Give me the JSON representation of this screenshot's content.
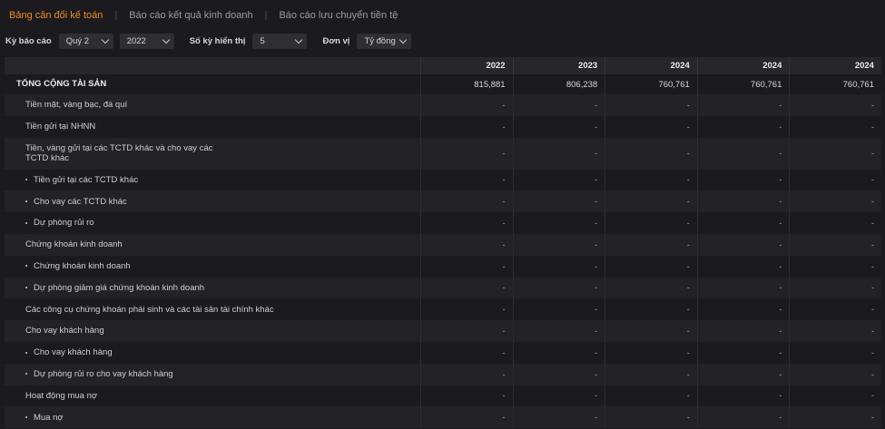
{
  "tabs": [
    {
      "label": "Bảng cân đối kế toán",
      "active": true
    },
    {
      "label": "Báo cáo kết quả kinh doanh",
      "active": false
    },
    {
      "label": "Báo cáo lưu chuyển tiền tệ",
      "active": false
    }
  ],
  "tab_separator": "|",
  "filters": {
    "period_label": "Kỳ báo cáo",
    "quarter_value": "Quý 2",
    "year_value": "2022",
    "count_label": "Số kỳ hiển thị",
    "count_value": "5",
    "unit_label": "Đơn vị",
    "unit_value": "Tỷ đồng"
  },
  "table": {
    "years": [
      "2022",
      "2023",
      "2024",
      "2024",
      "2024"
    ],
    "rows": [
      {
        "label": "TỔNG CỘNG TÀI SẢN",
        "values": [
          "815,881",
          "806,238",
          "760,761",
          "760,761",
          "760,761"
        ]
      },
      {
        "label": "Tiền mặt, vàng bạc, đá quí",
        "values": [
          "-",
          "-",
          "-",
          "-",
          "-"
        ]
      },
      {
        "label": "Tiền gửi tại NHNN",
        "values": [
          "-",
          "-",
          "-",
          "-",
          "-"
        ]
      },
      {
        "label_line1": "Tiền, vàng gửi tại các TCTD khác và cho vay các",
        "label_line2": "TCTD khác",
        "values": [
          "-",
          "-",
          "-",
          "-",
          "-"
        ]
      },
      {
        "label": "Tiền gửi tại các TCTD khác",
        "values": [
          "-",
          "-",
          "-",
          "-",
          "-"
        ]
      },
      {
        "label": "Cho vay các TCTD khác",
        "values": [
          "-",
          "-",
          "-",
          "-",
          "-"
        ]
      },
      {
        "label": "Dự phòng rủi ro",
        "values": [
          "-",
          "-",
          "-",
          "-",
          "-"
        ]
      },
      {
        "label": "Chứng khoán kinh doanh",
        "values": [
          "-",
          "-",
          "-",
          "-",
          "-"
        ]
      },
      {
        "label": "Chứng khoán kinh doanh",
        "values": [
          "-",
          "-",
          "-",
          "-",
          "-"
        ]
      },
      {
        "label": "Dự phòng giảm giá chứng khoán kinh doanh",
        "values": [
          "-",
          "-",
          "-",
          "-",
          "-"
        ]
      },
      {
        "label": "Các công cụ chứng khoán phái sinh và các tài sản tài chính khác",
        "values": [
          "-",
          "-",
          "-",
          "-",
          "-"
        ]
      },
      {
        "label": "Cho vay khách hàng",
        "values": [
          "-",
          "-",
          "-",
          "-",
          "-"
        ]
      },
      {
        "label": "Cho vay khách hàng",
        "values": [
          "-",
          "-",
          "-",
          "-",
          "-"
        ]
      },
      {
        "label": "Dự phòng rủi ro cho vay khách hàng",
        "values": [
          "-",
          "-",
          "-",
          "-",
          "-"
        ]
      },
      {
        "label": "Hoạt động mua nợ",
        "values": [
          "-",
          "-",
          "-",
          "-",
          "-"
        ]
      },
      {
        "label": "Mua nợ",
        "values": [
          "-",
          "-",
          "-",
          "-",
          "-"
        ]
      }
    ]
  }
}
